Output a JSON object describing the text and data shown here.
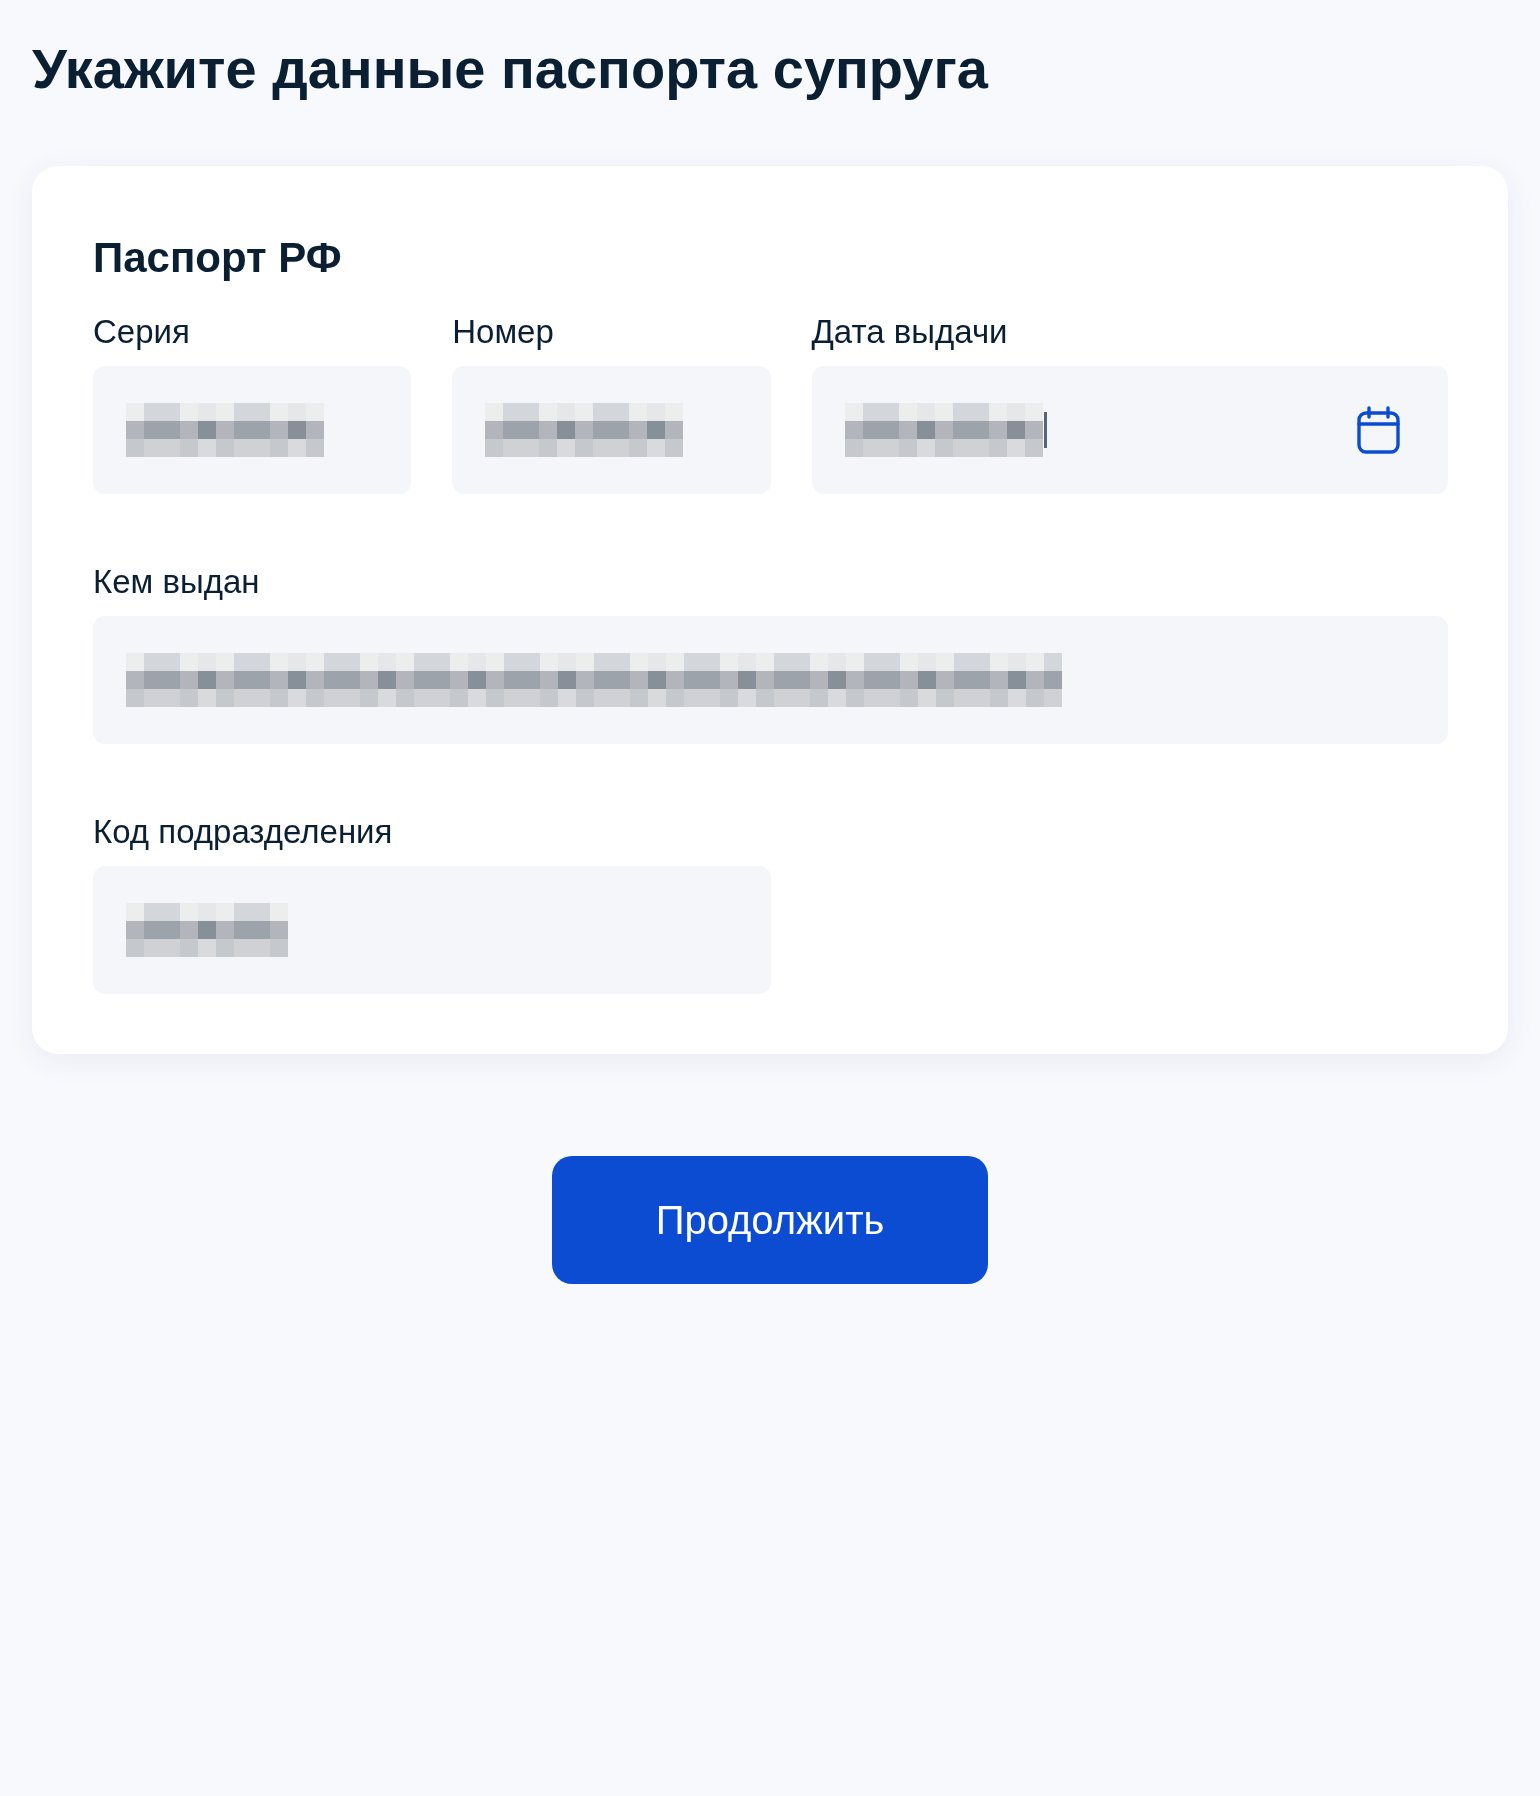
{
  "page": {
    "title": "Укажите данные паспорта супруга"
  },
  "card": {
    "heading": "Паспорт РФ",
    "fields": [
      {
        "label": "Серия",
        "kind": "text",
        "redacted": true,
        "focused": false
      },
      {
        "label": "Номер",
        "kind": "text",
        "redacted": true,
        "focused": false
      },
      {
        "label": "Дата выдачи",
        "kind": "date",
        "redacted": true,
        "focused": true
      },
      {
        "label": "Кем выдан",
        "kind": "text",
        "redacted": true,
        "focused": false
      },
      {
        "label": "Код подразделения",
        "kind": "text",
        "redacted": true,
        "focused": false
      }
    ]
  },
  "primary_button": {
    "label": "Продолжить"
  }
}
